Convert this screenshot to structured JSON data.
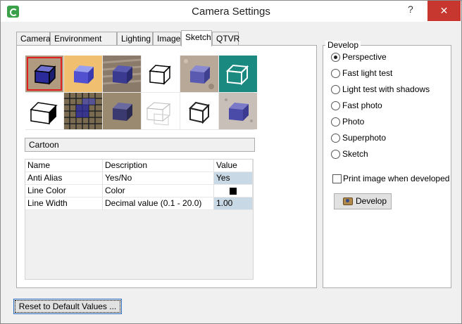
{
  "window": {
    "title": "Camera Settings",
    "help_label": "?",
    "close_label": "✕"
  },
  "tabs": [
    {
      "label": "Camera"
    },
    {
      "label": "Environment"
    },
    {
      "label": "Lighting"
    },
    {
      "label": "Image"
    },
    {
      "label": "Sketch",
      "active": true
    },
    {
      "label": "QTVR"
    }
  ],
  "sketch": {
    "selected_style": "Cartoon",
    "thumbnails": [
      "cartoon-style",
      "colored-pencil-style",
      "crayon-style",
      "line-drawing-style",
      "pastel-style",
      "chalkboard-style",
      "shaded-outline-style",
      "mosaic-style",
      "charcoal-style",
      "hidden-line-style",
      "pen-style",
      "watercolor-style"
    ],
    "properties": {
      "headers": [
        "Name",
        "Description",
        "Value"
      ],
      "rows": [
        {
          "name": "Anti Alias",
          "description": "Yes/No",
          "value": "Yes"
        },
        {
          "name": "Line Color",
          "description": "Color",
          "value": "",
          "color": "#000000"
        },
        {
          "name": "Line Width",
          "description": "Decimal value (0.1 - 20.0)",
          "value": "1.00"
        }
      ]
    }
  },
  "reset_label": "Reset to Default Values ...",
  "develop": {
    "legend": "Develop",
    "options": [
      {
        "label": "Perspective",
        "checked": true
      },
      {
        "label": "Fast light test"
      },
      {
        "label": "Light test with shadows"
      },
      {
        "label": "Fast photo"
      },
      {
        "label": "Photo"
      },
      {
        "label": "Superphoto"
      },
      {
        "label": "Sketch"
      }
    ],
    "print_label": "Print image when developed",
    "button_label": "Develop"
  }
}
